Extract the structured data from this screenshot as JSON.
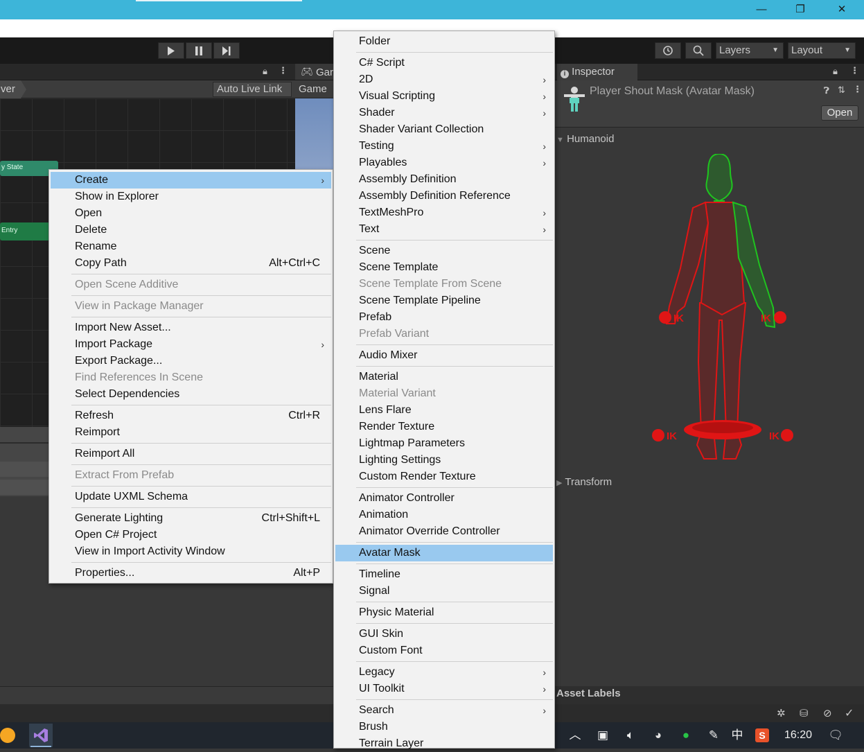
{
  "window": {
    "minimize_glyph": "—",
    "restore_glyph": "❐",
    "close_glyph": "✕"
  },
  "toolbar": {
    "play_icon": "play-icon",
    "pause_icon": "pause-icon",
    "step_icon": "step-icon",
    "layers_label": "Layers",
    "layout_label": "Layout"
  },
  "animator_panel": {
    "breadcrumb_partial": "ver",
    "auto_live_link": "Auto Live Link",
    "nodes": [
      {
        "label": "y State",
        "color": "#2f8a6a"
      },
      {
        "label": "Entry",
        "color": "#1f7b45"
      }
    ]
  },
  "game_panel": {
    "tab_label_partial": "Gar",
    "sub_label": "Game"
  },
  "context_menu": {
    "items": [
      {
        "label": "Create",
        "submenu": true,
        "highlighted": true
      },
      {
        "label": "Show in Explorer"
      },
      {
        "label": "Open"
      },
      {
        "label": "Delete"
      },
      {
        "label": "Rename"
      },
      {
        "label": "Copy Path",
        "shortcut": "Alt+Ctrl+C"
      },
      {
        "label": "Open Scene Additive",
        "disabled": true
      },
      {
        "label": "View in Package Manager",
        "disabled": true
      },
      {
        "label": "Import New Asset..."
      },
      {
        "label": "Import Package",
        "submenu": true
      },
      {
        "label": "Export Package..."
      },
      {
        "label": "Find References In Scene",
        "disabled": true
      },
      {
        "label": "Select Dependencies"
      },
      {
        "label": "Refresh",
        "shortcut": "Ctrl+R"
      },
      {
        "label": "Reimport"
      },
      {
        "label": "Reimport All"
      },
      {
        "label": "Extract From Prefab",
        "disabled": true
      },
      {
        "label": "Update UXML Schema"
      },
      {
        "label": "Generate Lighting",
        "shortcut": "Ctrl+Shift+L"
      },
      {
        "label": "Open C# Project"
      },
      {
        "label": "View in Import Activity Window"
      },
      {
        "label": "Properties...",
        "shortcut": "Alt+P"
      }
    ]
  },
  "create_submenu": {
    "items": [
      {
        "label": "Folder"
      },
      {
        "label": "C# Script"
      },
      {
        "label": "2D",
        "submenu": true
      },
      {
        "label": "Visual Scripting",
        "submenu": true
      },
      {
        "label": "Shader",
        "submenu": true
      },
      {
        "label": "Shader Variant Collection"
      },
      {
        "label": "Testing",
        "submenu": true
      },
      {
        "label": "Playables",
        "submenu": true
      },
      {
        "label": "Assembly Definition"
      },
      {
        "label": "Assembly Definition Reference"
      },
      {
        "label": "TextMeshPro",
        "submenu": true
      },
      {
        "label": "Text",
        "submenu": true
      },
      {
        "label": "Scene"
      },
      {
        "label": "Scene Template"
      },
      {
        "label": "Scene Template From Scene",
        "disabled": true
      },
      {
        "label": "Scene Template Pipeline"
      },
      {
        "label": "Prefab"
      },
      {
        "label": "Prefab Variant",
        "disabled": true
      },
      {
        "label": "Audio Mixer"
      },
      {
        "label": "Material"
      },
      {
        "label": "Material Variant",
        "disabled": true
      },
      {
        "label": "Lens Flare"
      },
      {
        "label": "Render Texture"
      },
      {
        "label": "Lightmap Parameters"
      },
      {
        "label": "Lighting Settings"
      },
      {
        "label": "Custom Render Texture"
      },
      {
        "label": "Animator Controller"
      },
      {
        "label": "Animation"
      },
      {
        "label": "Animator Override Controller"
      },
      {
        "label": "Avatar Mask",
        "highlighted": true
      },
      {
        "label": "Timeline"
      },
      {
        "label": "Signal"
      },
      {
        "label": "Physic Material"
      },
      {
        "label": "GUI Skin"
      },
      {
        "label": "Custom Font"
      },
      {
        "label": "Legacy",
        "submenu": true
      },
      {
        "label": "UI Toolkit",
        "submenu": true
      },
      {
        "label": "Search",
        "submenu": true
      },
      {
        "label": "Brush"
      },
      {
        "label": "Terrain Layer"
      }
    ]
  },
  "inspector": {
    "tab_label": "Inspector",
    "title": "Player Shout Mask (Avatar Mask)",
    "open_button": "Open",
    "humanoid_label": "Humanoid",
    "transform_label": "Transform",
    "asset_labels": "Asset Labels",
    "ik_label": "IK",
    "colors": {
      "enabled": "#1fc41f",
      "disabled": "#e01515",
      "enabled_fill": "#2e5a2e",
      "disabled_fill": "#5a2a2a"
    }
  },
  "taskbar": {
    "clock": "16:20",
    "ime": "中"
  }
}
